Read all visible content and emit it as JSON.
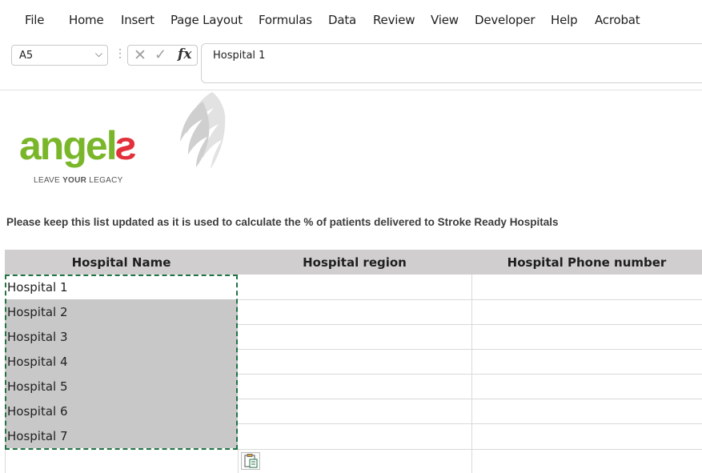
{
  "ribbon": {
    "tabs": [
      "File",
      "Home",
      "Insert",
      "Page Layout",
      "Formulas",
      "Data",
      "Review",
      "View",
      "Developer",
      "Help",
      "Acrobat"
    ]
  },
  "formula_bar": {
    "name_box": "A5",
    "formula": "Hospital 1"
  },
  "logo": {
    "word_green": "angel",
    "word_red": "s",
    "tagline_a": "LEAVE ",
    "tagline_b": "YOUR",
    "tagline_c": " LEGACY"
  },
  "sheet": {
    "instruction": "Please keep this list updated as it is used to calculate the % of patients delivered to Stroke Ready Hospitals",
    "headers": [
      "Hospital Name",
      "Hospital region",
      "Hospital Phone number"
    ],
    "rows": [
      "Hospital 1",
      "Hospital 2",
      "Hospital 3",
      "Hospital 4",
      "Hospital 5",
      "Hospital 6",
      "Hospital 7"
    ]
  },
  "colors": {
    "header_fill": "#d0cecf",
    "selection_fill": "#c8c8c8",
    "marquee": "#217346",
    "logo_green": "#7ab629",
    "logo_red": "#e2313b"
  }
}
